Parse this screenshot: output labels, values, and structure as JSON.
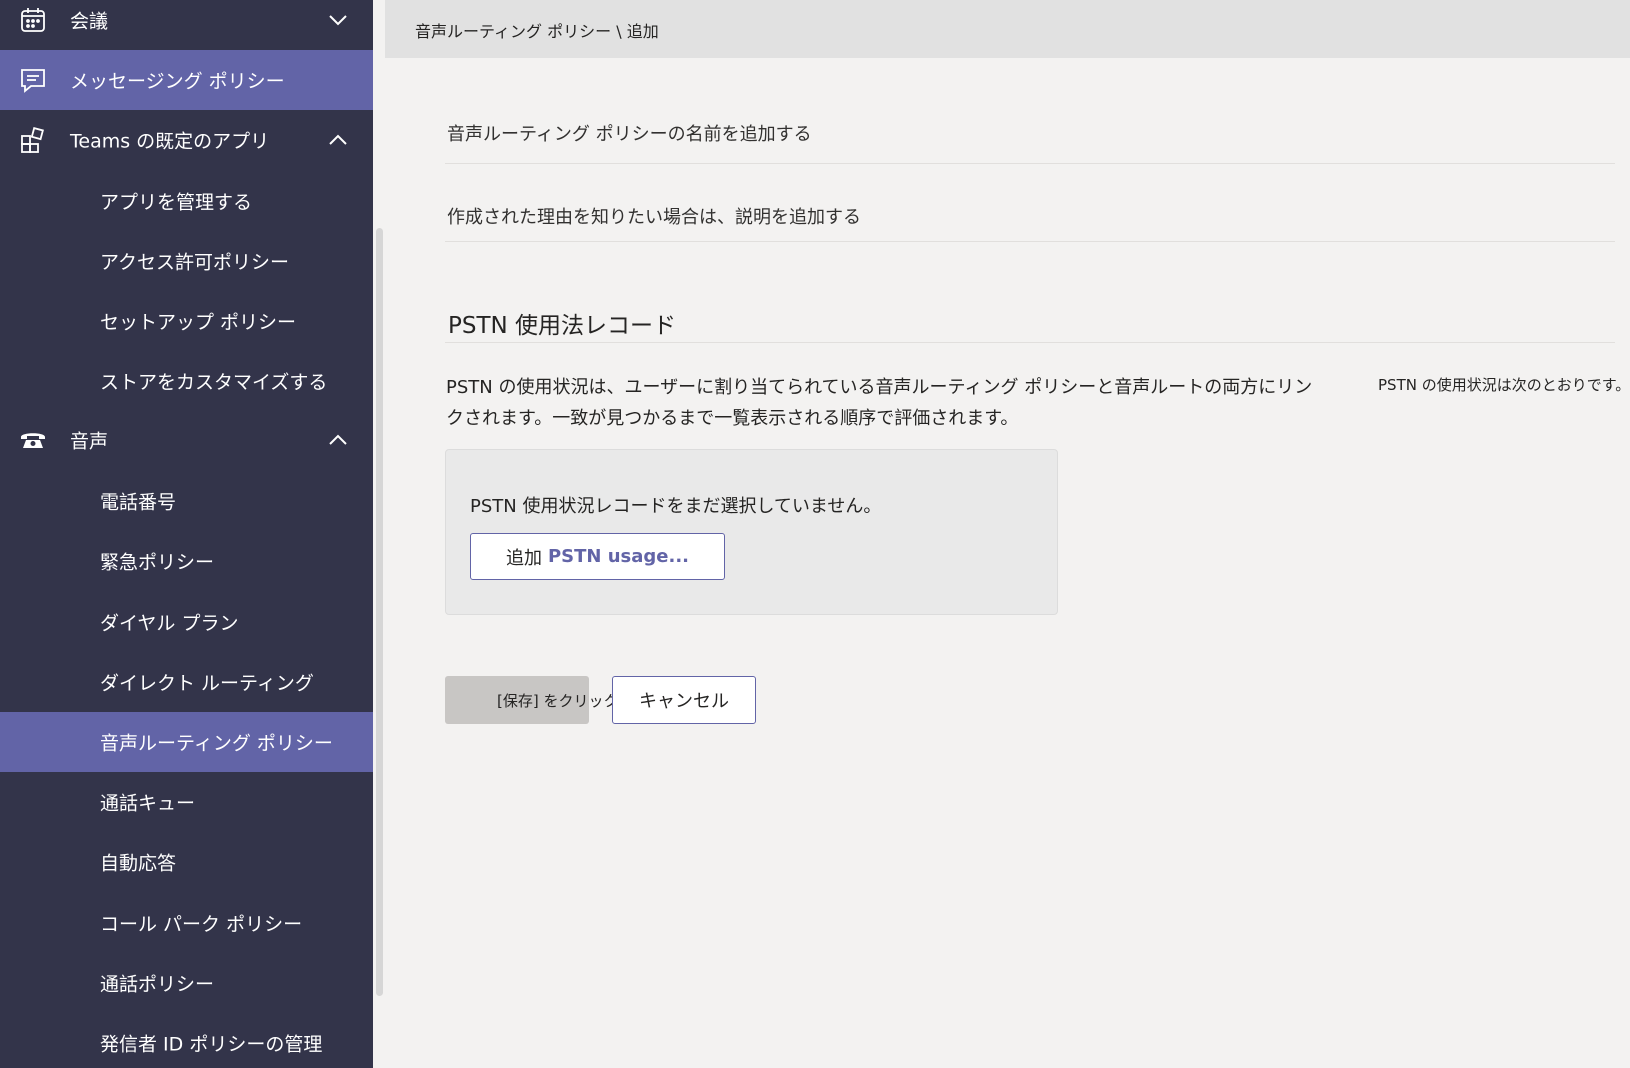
{
  "sidebar": {
    "items": [
      {
        "label": "会議",
        "icon": "calendar-icon",
        "expand": "down"
      },
      {
        "label": "メッセージング ポリシー",
        "icon": "chat-icon",
        "active": true
      },
      {
        "label": "Teams の既定のアプリ",
        "icon": "apps-icon",
        "expand": "up"
      },
      {
        "label": "アプリを管理する"
      },
      {
        "label": "アクセス許可ポリシー"
      },
      {
        "label": "セットアップ ポリシー"
      },
      {
        "label": "ストアをカスタマイズする"
      },
      {
        "label": "音声",
        "icon": "phone-icon",
        "expand": "up"
      },
      {
        "label": "電話番号"
      },
      {
        "label": "緊急ポリシー"
      },
      {
        "label": "ダイヤル プラン"
      },
      {
        "label": "ダイレクト ルーティング"
      },
      {
        "label": "音声ルーティング ポリシー",
        "active": true
      },
      {
        "label": "通話キュー"
      },
      {
        "label": "自動応答"
      },
      {
        "label": "コール パーク ポリシー"
      },
      {
        "label": "通話ポリシー"
      },
      {
        "label": "発信者 ID ポリシーの管理"
      }
    ]
  },
  "header": {
    "breadcrumb": "音声ルーティング ポリシー \\ 追加"
  },
  "form": {
    "name_placeholder": "音声ルーティング ポリシーの名前を追加する",
    "description_placeholder": "作成された理由を知りたい場合は、説明を追加する"
  },
  "pstn": {
    "title": "PSTN 使用法レコード",
    "description": "PSTN の使用状況は、ユーザーに割り当てられている音声ルーティング ポリシーと音声ルートの両方にリンクされます。一致が見つかるまで一覧表示される順序で評価されます。",
    "side_note": "PSTN の使用状況は次のとおりです。",
    "empty_message": "PSTN 使用状況レコードをまだ選択していません。",
    "add_button_prefix": "追加",
    "add_button_accent": "PSTN usage..."
  },
  "actions": {
    "save_label": "[保存] をクリックします。",
    "cancel_label": "キャンセル"
  },
  "colors": {
    "sidebar_bg": "#33344a",
    "accent": "#6264a7",
    "content_bg": "#f3f2f1"
  }
}
